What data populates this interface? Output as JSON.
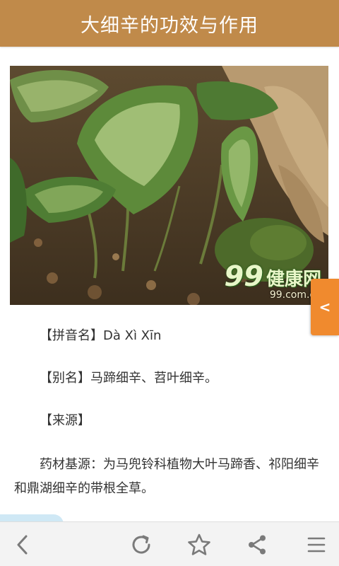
{
  "header": {
    "title": "大细辛的功效与作用"
  },
  "photo": {
    "watermark_logo": "99",
    "watermark_brand": "健康网",
    "watermark_domain": "99.com.cn"
  },
  "side_tab": {
    "label": "<"
  },
  "article": {
    "pinyin_label": "【拼音名】",
    "pinyin_value": "Dà Xì Xīn",
    "alias_label": "【别名】",
    "alias_value": "马蹄细辛、苕叶细辛。",
    "source_label": "【来源】",
    "source_text": "药材基源：为马兜铃科植物大叶马蹄香、祁阳细辛和鼎湖细辛的带根全草。"
  },
  "toolbar": {
    "back_icon": "chevron-left-icon",
    "refresh_icon": "refresh-icon",
    "bookmark_icon": "star-icon",
    "share_icon": "share-icon",
    "menu_icon": "menu-icon"
  },
  "colors": {
    "header_bg": "#c08a4a",
    "side_tab_bg": "#f08a2e",
    "toolbar_bg": "#f3f3f3",
    "icon": "#7a7a7a"
  }
}
